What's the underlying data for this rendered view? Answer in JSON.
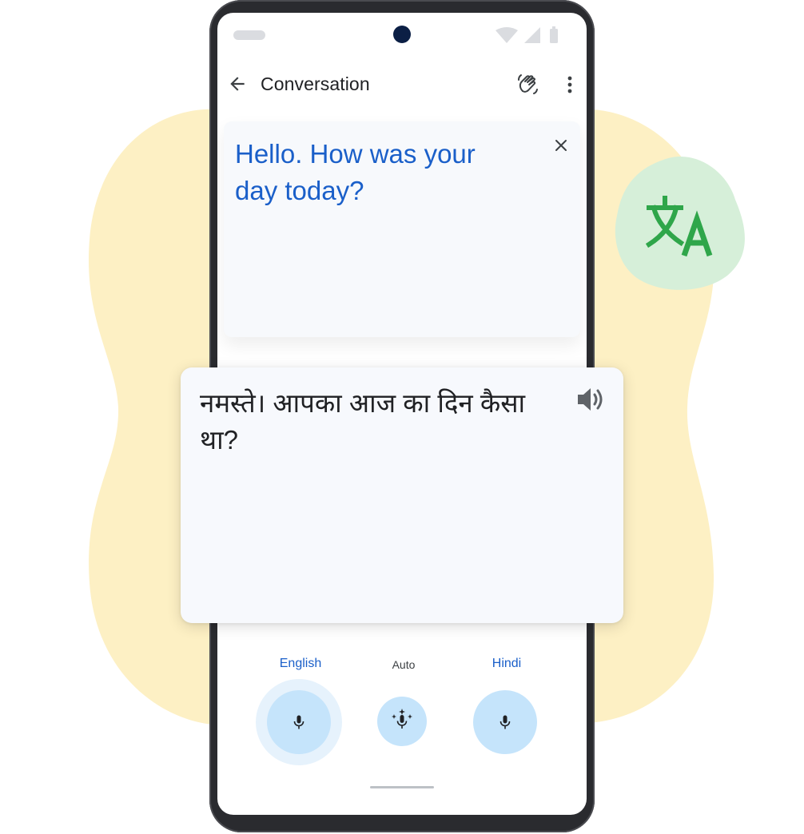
{
  "colors": {
    "accent_blue": "#1a5fc9",
    "mic_fill": "#c5e4fb",
    "blob_yellow": "#fdf0c4",
    "blob_green": "#d6efd9",
    "logo_green": "#2fa64a"
  },
  "status_bar": {
    "icons": [
      "wifi-icon",
      "signal-icon",
      "battery-icon"
    ]
  },
  "app_bar": {
    "title": "Conversation",
    "icons": [
      "back-arrow-icon",
      "waving-hand-icon",
      "more-vert-icon"
    ]
  },
  "source": {
    "text": "Hello. How was your day today?",
    "icon": "close-icon"
  },
  "translation": {
    "text": "नमस्ते। आपका आज का दिन कैसा था?",
    "icon": "speaker-icon"
  },
  "languages": {
    "left": "English",
    "middle": "Auto",
    "right": "Hindi"
  },
  "mic_icons": [
    "mic-icon",
    "auto-mic-sparkle-icon",
    "mic-icon"
  ],
  "decor": {
    "logo_icon": "google-translate-icon"
  }
}
